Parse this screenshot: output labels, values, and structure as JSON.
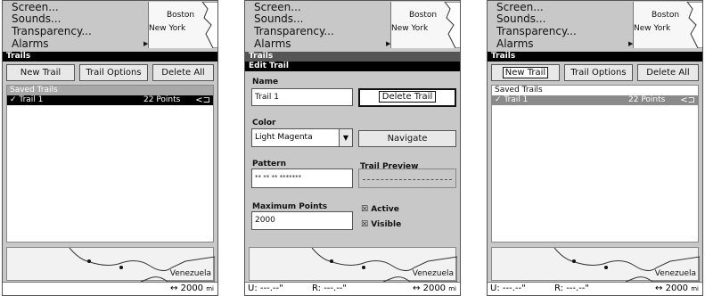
{
  "menu": {
    "items": [
      "Screen...",
      "Sounds...",
      "Transparency...",
      "Alarms"
    ],
    "map_labels": [
      "Boston",
      "New York"
    ]
  },
  "panel1": {
    "title": "Trails",
    "buttons": [
      "New Trail",
      "Trail Options",
      "Delete All"
    ],
    "list_header": "Saved Trails",
    "rows": [
      {
        "name": "Trail 1",
        "points": "22 Points",
        "checked": "✓"
      }
    ],
    "bottom_label": "Venezuela",
    "scale": "2000",
    "scale_unit": "mi"
  },
  "panel2": {
    "title": "Trails",
    "dialog_title": "Edit Trail",
    "name_label": "Name",
    "name_value": "Trail 1",
    "delete_button": "Delete Trail",
    "color_label": "Color",
    "color_value": "Light Magenta",
    "navigate_button": "Navigate",
    "pattern_label": "Pattern",
    "pattern_value": "**  **  **  *******",
    "preview_label": "Trail Preview",
    "max_label": "Maximum Points",
    "max_value": "2000",
    "active_label": "Active",
    "visible_label": "Visible",
    "bottom_label": "Venezuela",
    "u_readout": "U:  ---.--\"",
    "r_readout": "R:  ---.--\"",
    "scale": "2000",
    "scale_unit": "mi"
  },
  "panel3": {
    "title": "Trails",
    "buttons": [
      "New Trail",
      "Trail Options",
      "Delete All"
    ],
    "list_header": "Saved Trails",
    "rows": [
      {
        "name": "Trail 1",
        "points": "22 Points",
        "checked": "✓"
      }
    ],
    "bottom_label": "Venezuela",
    "u_readout": "U:  ---.--\"",
    "r_readout": "R:  ---.--\"",
    "scale": "2000",
    "scale_unit": "mi"
  },
  "icons": {
    "cursor": "cursor-arrow-icon",
    "scale": "double-arrow-icon",
    "dropdown": "chevron-down-icon",
    "checkbox": "checkbox-x-icon"
  },
  "colors": {
    "title_bar": "#000000",
    "background": "#c8c8c8",
    "selected_row": "#000000"
  }
}
